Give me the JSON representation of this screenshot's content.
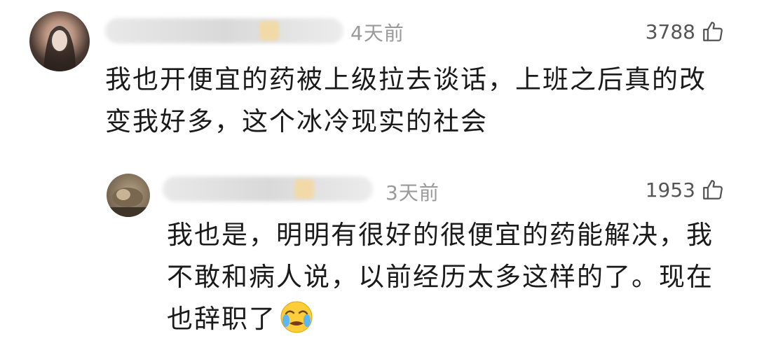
{
  "comments": [
    {
      "time": "4天前",
      "likes": "3788",
      "text_lines": [
        "我也开便宜的药被上级拉去谈话，上班之后真的改",
        "变我好多，这个冰冷现实的社会"
      ]
    },
    {
      "time": "3天前",
      "likes": "1953",
      "text_lines": [
        "我也是，明明有很好的很便宜的药能解决，我",
        "不敢和病人说，以前经历太多这样的了。现在",
        "也辞职了"
      ],
      "emoji": "crying-face-icon"
    }
  ]
}
